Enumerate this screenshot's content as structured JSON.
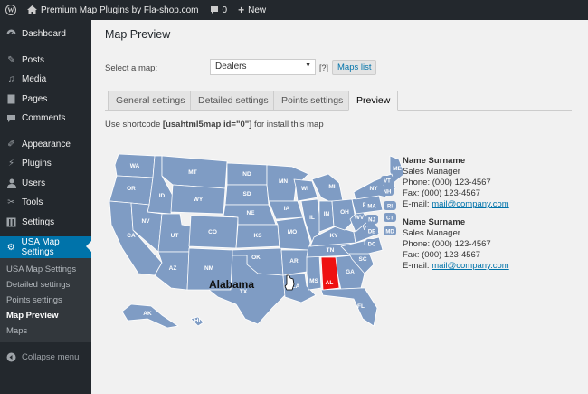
{
  "adminbar": {
    "site_name": "Premium Map Plugins by Fla-shop.com",
    "comments_count": "0",
    "new_label": "New"
  },
  "sidebar": {
    "items": [
      {
        "label": "Dashboard",
        "icon": "dashboard-icon"
      },
      {
        "label": "Posts",
        "icon": "pin-icon"
      },
      {
        "label": "Media",
        "icon": "media-icon"
      },
      {
        "label": "Pages",
        "icon": "page-icon"
      },
      {
        "label": "Comments",
        "icon": "comment-icon"
      },
      {
        "label": "Appearance",
        "icon": "brush-icon"
      },
      {
        "label": "Plugins",
        "icon": "plug-icon"
      },
      {
        "label": "Users",
        "icon": "user-icon"
      },
      {
        "label": "Tools",
        "icon": "wrench-icon"
      },
      {
        "label": "Settings",
        "icon": "settings-icon"
      },
      {
        "label": "USA Map Settings",
        "icon": "gear-icon"
      }
    ],
    "submenu": [
      "USA Map Settings",
      "Detailed settings",
      "Points settings",
      "Map Preview",
      "Maps"
    ],
    "collapse_label": "Collapse menu"
  },
  "page": {
    "title": "Map Preview",
    "select_label": "Select a map:",
    "selected_map": "Dealers",
    "help": "[?]",
    "maps_list_button": "Maps list",
    "tabs": [
      "General settings",
      "Detailed settings",
      "Points settings",
      "Preview"
    ],
    "active_tab": "Preview",
    "shortcode_prefix": "Use shortcode ",
    "shortcode": "[usahtml5map id=\"0\"]",
    "shortcode_suffix": " for install this map"
  },
  "map": {
    "state_color": "#7f9cc4",
    "highlight_color": "#ee1111",
    "highlighted_state": "AL",
    "highlighted_name": "Alabama",
    "state_labels": [
      "WA",
      "OR",
      "CA",
      "ID",
      "NV",
      "MT",
      "WY",
      "UT",
      "AZ",
      "CO",
      "NM",
      "ND",
      "SD",
      "NE",
      "KS",
      "OK",
      "TX",
      "MN",
      "IA",
      "MO",
      "AR",
      "LA",
      "WI",
      "IL",
      "MS",
      "AL",
      "TN",
      "KY",
      "IN",
      "MI",
      "OH",
      "GA",
      "FL",
      "SC",
      "NC",
      "VA",
      "WV",
      "PA",
      "NY",
      "ME",
      "AK",
      "HI"
    ],
    "small_state_labels": [
      "VT",
      "NH",
      "MA",
      "RI",
      "CT",
      "NJ",
      "DE",
      "MD",
      "DC"
    ]
  },
  "contacts": [
    {
      "name": "Name Surname",
      "title": "Sales Manager",
      "phone": "Phone: (000) 123-4567",
      "fax": "Fax: (000) 123-4567",
      "email_label": "E-mail: ",
      "email": "mail@company.com"
    },
    {
      "name": "Name Surname",
      "title": "Sales Manager",
      "phone": "Phone: (000) 123-4567",
      "fax": "Fax: (000) 123-4567",
      "email_label": "E-mail: ",
      "email": "mail@company.com"
    }
  ]
}
